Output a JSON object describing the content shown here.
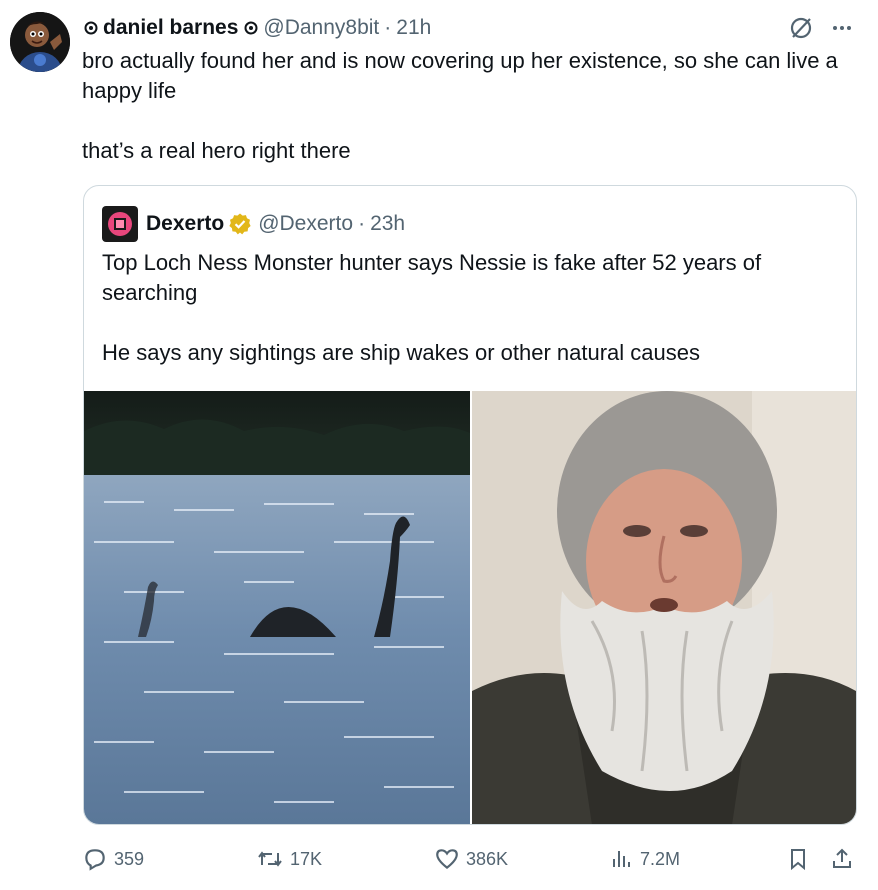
{
  "tweet": {
    "author_name": "daniel barnes",
    "handle": "@Danny8bit",
    "separator": "·",
    "time": "21h",
    "text": "bro actually found her and is now covering up her existence, so she can live a happy life\n\nthat’s a real hero right there",
    "icons": [
      "avatar",
      "badge-icon",
      "slash-circle-icon",
      "more-icon"
    ]
  },
  "quoted": {
    "author_name": "Dexerto",
    "handle": "@Dexerto",
    "separator": "·",
    "time": "23h",
    "text": "Top Loch Ness Monster hunter says Nessie is fake after 52 years of searching\n\nHe says any sightings are ship wakes or other natural causes",
    "verified_color": "#e2b719",
    "media": [
      "loch-ness-monster-photo",
      "bearded-man-photo"
    ]
  },
  "actions": {
    "replies": "359",
    "reposts": "17K",
    "likes": "386K",
    "views": "7.2M"
  },
  "colors": {
    "text": "#0f1419",
    "secondary": "#536471",
    "border": "#cfd9de"
  }
}
